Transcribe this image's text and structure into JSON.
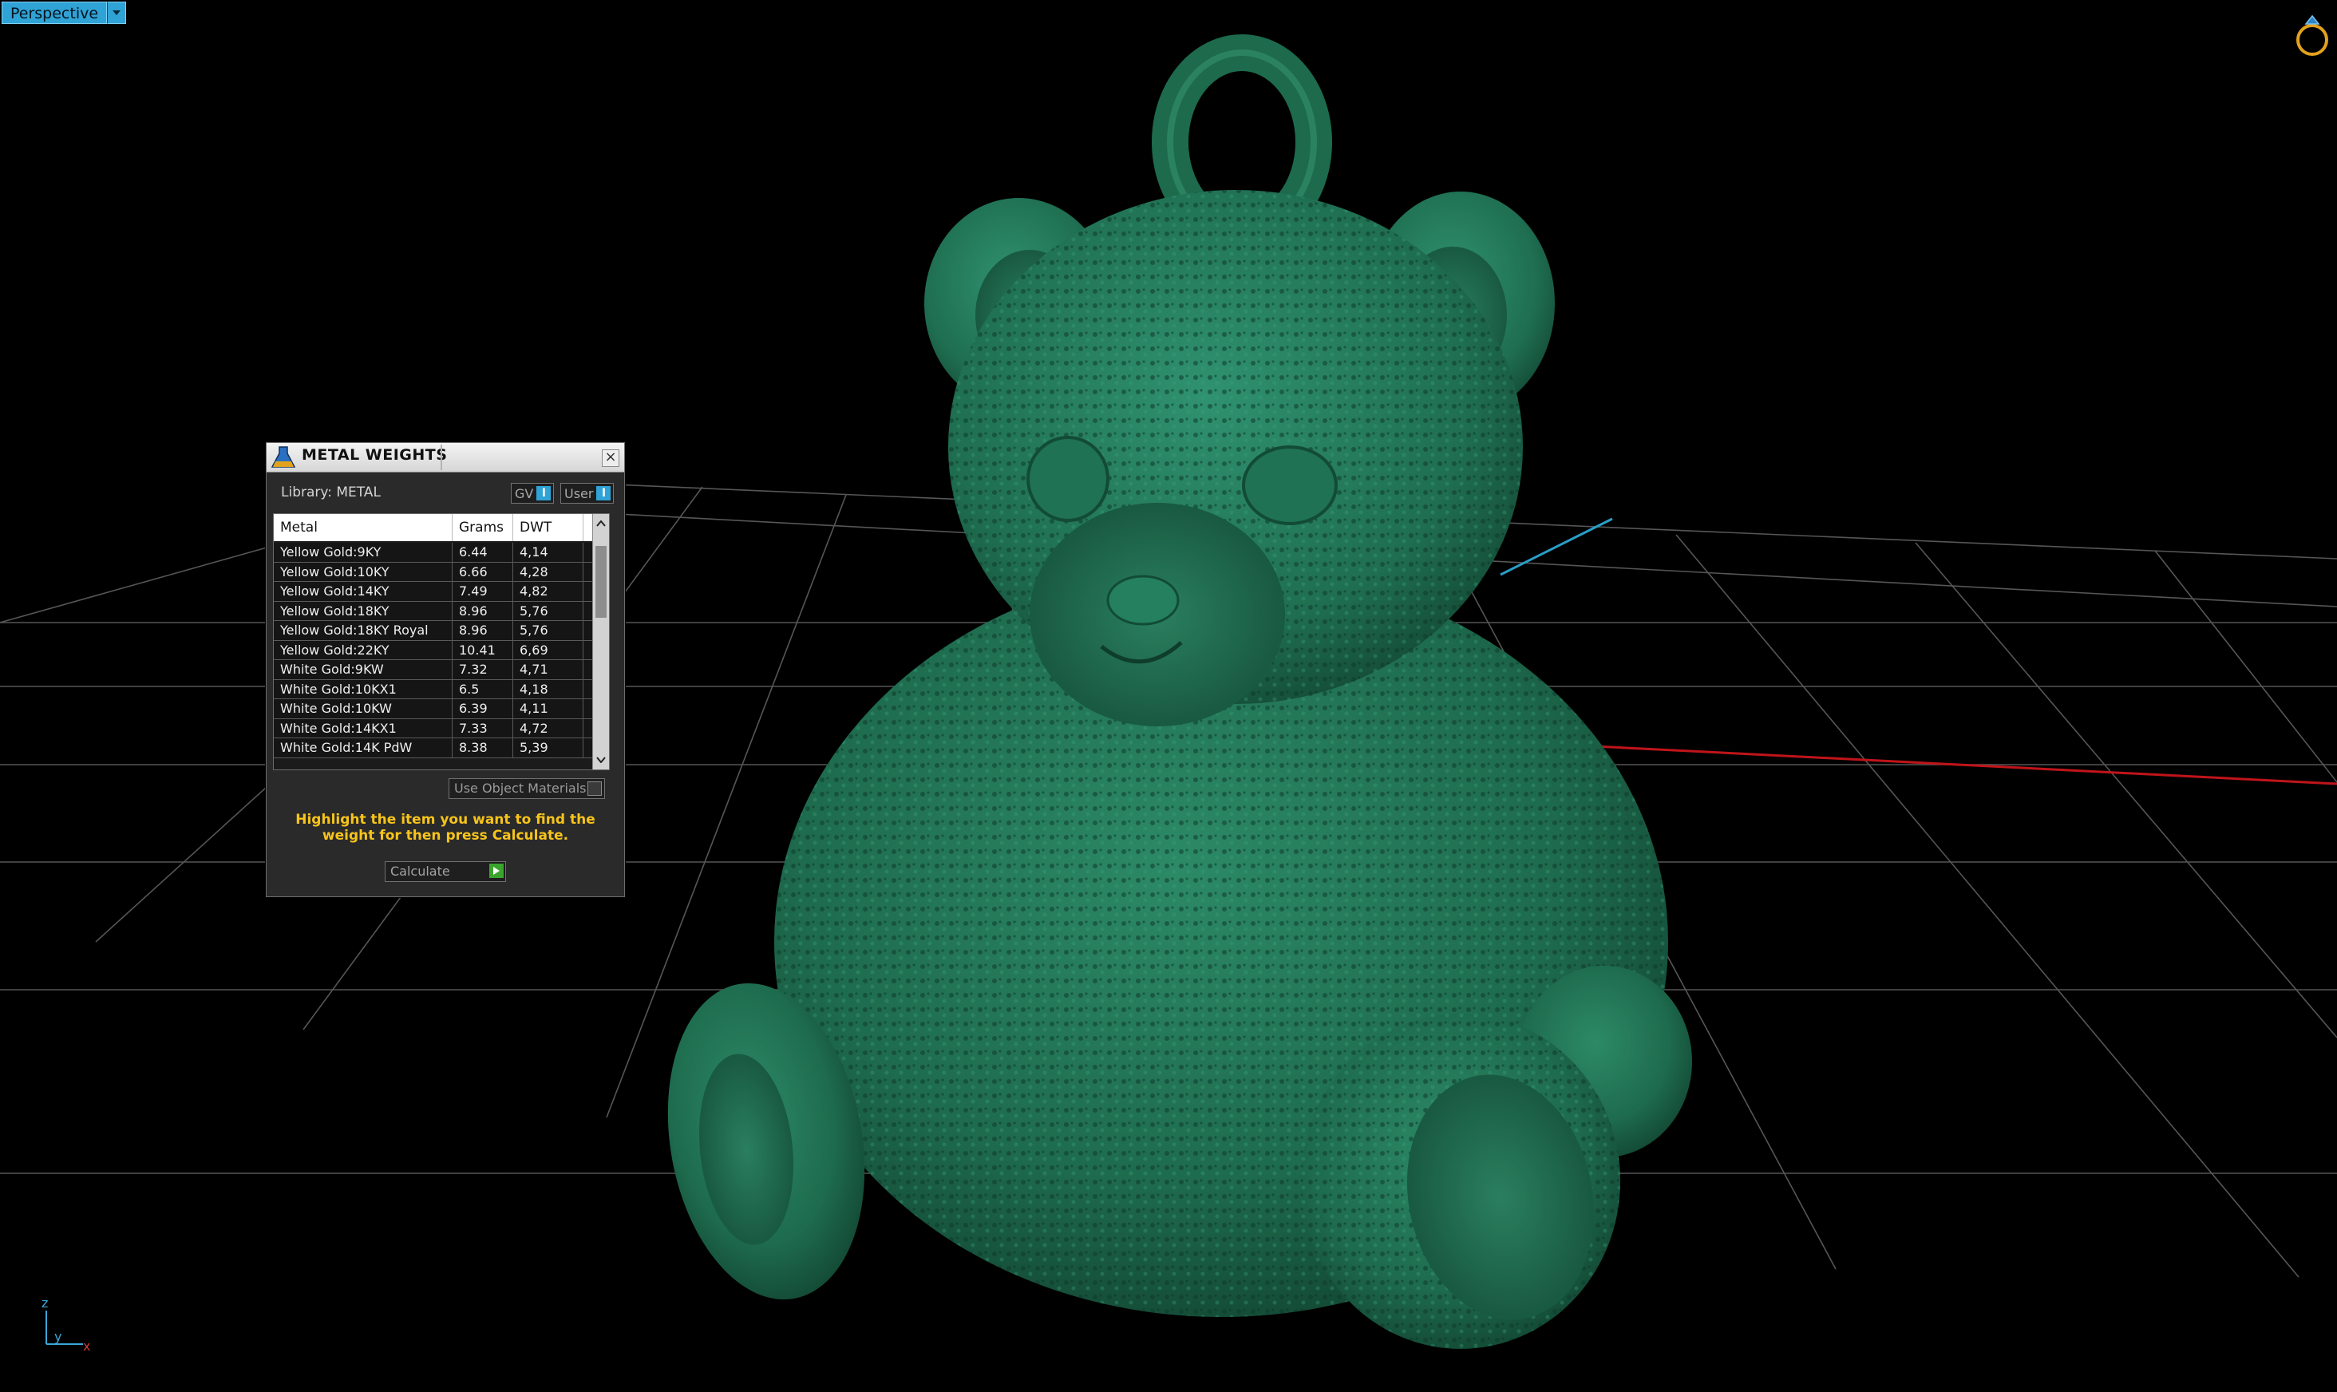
{
  "viewport": {
    "view_name": "Perspective",
    "object_color": "#1e6b4e",
    "grid_color": "#6e6e6e",
    "x_axis_color": "#c0141a",
    "y_axis_color": "#2a9ec8",
    "axes": {
      "z": "z",
      "y": "y",
      "x": "x"
    }
  },
  "metal_weights": {
    "title": "METAL WEIGHTS",
    "library_label": "Library: METAL",
    "toggle_gv": "GV",
    "toggle_user": "User",
    "toggle_mark": "I",
    "columns": [
      "Metal",
      "Grams",
      "DWT"
    ],
    "rows": [
      [
        "Yellow Gold:9KY",
        "6.44",
        "4,14"
      ],
      [
        "Yellow Gold:10KY",
        "6.66",
        "4,28"
      ],
      [
        "Yellow Gold:14KY",
        "7.49",
        "4,82"
      ],
      [
        "Yellow Gold:18KY",
        "8.96",
        "5,76"
      ],
      [
        "Yellow Gold:18KY Royal",
        "8.96",
        "5,76"
      ],
      [
        "Yellow Gold:22KY",
        "10.41",
        "6,69"
      ],
      [
        "White Gold:9KW",
        "7.32",
        "4,71"
      ],
      [
        "White Gold:10KX1",
        "6.5",
        "4,18"
      ],
      [
        "White Gold:10KW",
        "6.39",
        "4,11"
      ],
      [
        "White Gold:14KX1",
        "7.33",
        "4,72"
      ],
      [
        "White Gold:14K PdW",
        "8.38",
        "5,39"
      ]
    ],
    "use_object_materials": "Use Object Materials",
    "hint": "Highlight the item you want to find the weight for then press Calculate.",
    "calculate_label": "Calculate",
    "accent": "#f7c41b"
  }
}
